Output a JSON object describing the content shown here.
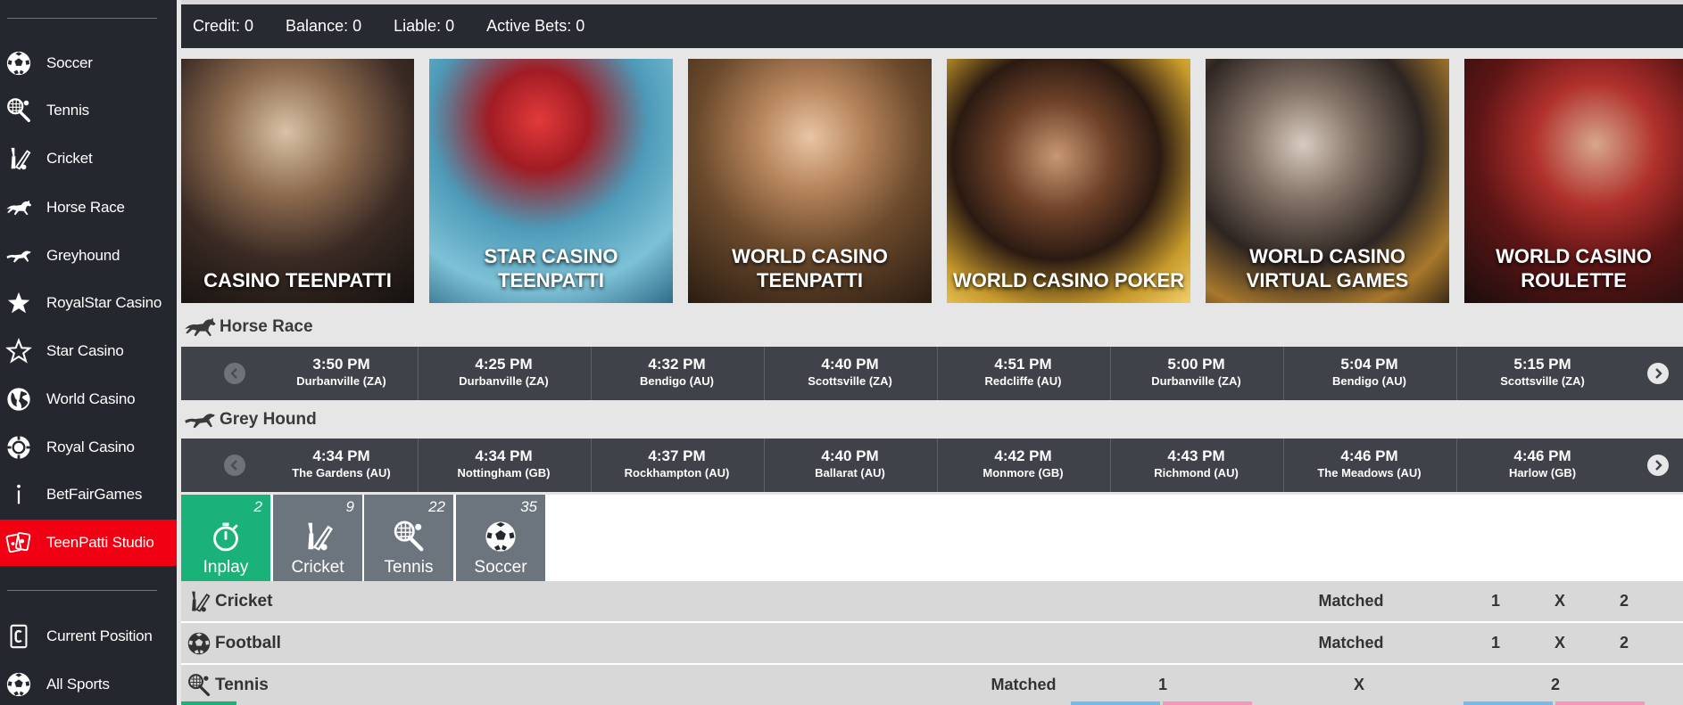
{
  "sidebar": {
    "items": [
      {
        "label": "Soccer",
        "icon": "soccer-ball-icon"
      },
      {
        "label": "Tennis",
        "icon": "tennis-racket-icon"
      },
      {
        "label": "Cricket",
        "icon": "cricket-bat-icon"
      },
      {
        "label": "Horse Race",
        "icon": "horse-icon"
      },
      {
        "label": "Greyhound",
        "icon": "greyhound-icon"
      },
      {
        "label": "RoyalStar Casino",
        "icon": "star-solid-icon"
      },
      {
        "label": "Star Casino",
        "icon": "star-outline-icon"
      },
      {
        "label": "World Casino",
        "icon": "globe-icon"
      },
      {
        "label": "Royal Casino",
        "icon": "casino-chip-icon"
      },
      {
        "label": "BetFairGames",
        "icon": "info-icon"
      },
      {
        "label": "TeenPatti Studio",
        "icon": "playing-cards-icon",
        "active": true
      }
    ],
    "footer_items": [
      {
        "label": "Current Position",
        "icon": "position-icon"
      },
      {
        "label": "All Sports",
        "icon": "soccer-ball-icon"
      }
    ],
    "active_color": "#f00012"
  },
  "stats": {
    "credit": "Credit: 0",
    "balance": "Balance: 0",
    "liable": "Liable: 0",
    "active_bets": "Active Bets: 0"
  },
  "banners": [
    {
      "title": "CASINO TEENPATTI"
    },
    {
      "title": "STAR CASINO TEENPATTI"
    },
    {
      "title": "WORLD CASINO TEENPATTI"
    },
    {
      "title": "WORLD CASINO POKER"
    },
    {
      "title": "WORLD CASINO VIRTUAL GAMES"
    },
    {
      "title": "WORLD CASINO ROULETTE"
    }
  ],
  "horse_race": {
    "heading": "Horse Race",
    "races": [
      {
        "time": "3:50 PM",
        "venue": "Durbanville (ZA)"
      },
      {
        "time": "4:25 PM",
        "venue": "Durbanville (ZA)"
      },
      {
        "time": "4:32 PM",
        "venue": "Bendigo (AU)"
      },
      {
        "time": "4:40 PM",
        "venue": "Scottsville (ZA)"
      },
      {
        "time": "4:51 PM",
        "venue": "Redcliffe (AU)"
      },
      {
        "time": "5:00 PM",
        "venue": "Durbanville (ZA)"
      },
      {
        "time": "5:04 PM",
        "venue": "Bendigo (AU)"
      },
      {
        "time": "5:15 PM",
        "venue": "Scottsville (ZA)"
      }
    ]
  },
  "grey_hound": {
    "heading": "Grey Hound",
    "races": [
      {
        "time": "4:34 PM",
        "venue": "The Gardens (AU)"
      },
      {
        "time": "4:34 PM",
        "venue": "Nottingham (GB)"
      },
      {
        "time": "4:37 PM",
        "venue": "Rockhampton (AU)"
      },
      {
        "time": "4:40 PM",
        "venue": "Ballarat (AU)"
      },
      {
        "time": "4:42 PM",
        "venue": "Monmore (GB)"
      },
      {
        "time": "4:43 PM",
        "venue": "Richmond (AU)"
      },
      {
        "time": "4:46 PM",
        "venue": "The Meadows (AU)"
      },
      {
        "time": "4:46 PM",
        "venue": "Harlow (GB)"
      }
    ]
  },
  "sport_tabs": [
    {
      "label": "Inplay",
      "count": "2",
      "icon": "stopwatch-icon",
      "active": true
    },
    {
      "label": "Cricket",
      "count": "9",
      "icon": "cricket-bat-icon"
    },
    {
      "label": "Tennis",
      "count": "22",
      "icon": "tennis-racket-icon"
    },
    {
      "label": "Soccer",
      "count": "35",
      "icon": "soccer-ball-icon"
    }
  ],
  "market_rows": [
    {
      "label": "Cricket",
      "icon": "cricket-bat-icon",
      "matched": "Matched",
      "c1": "1",
      "cx": "X",
      "c2": "2"
    },
    {
      "label": "Football",
      "icon": "soccer-ball-icon",
      "matched": "Matched",
      "c1": "1",
      "cx": "X",
      "c2": "2"
    },
    {
      "label": "Tennis",
      "icon": "tennis-racket-icon",
      "matched": "Matched",
      "c1": "1",
      "cx": "X",
      "c2": "2"
    }
  ],
  "colors": {
    "sidebar_bg": "#24272e",
    "inplay_green": "#1ab278",
    "tab_grey": "#6c757d",
    "race_bar": "#3f4249"
  }
}
